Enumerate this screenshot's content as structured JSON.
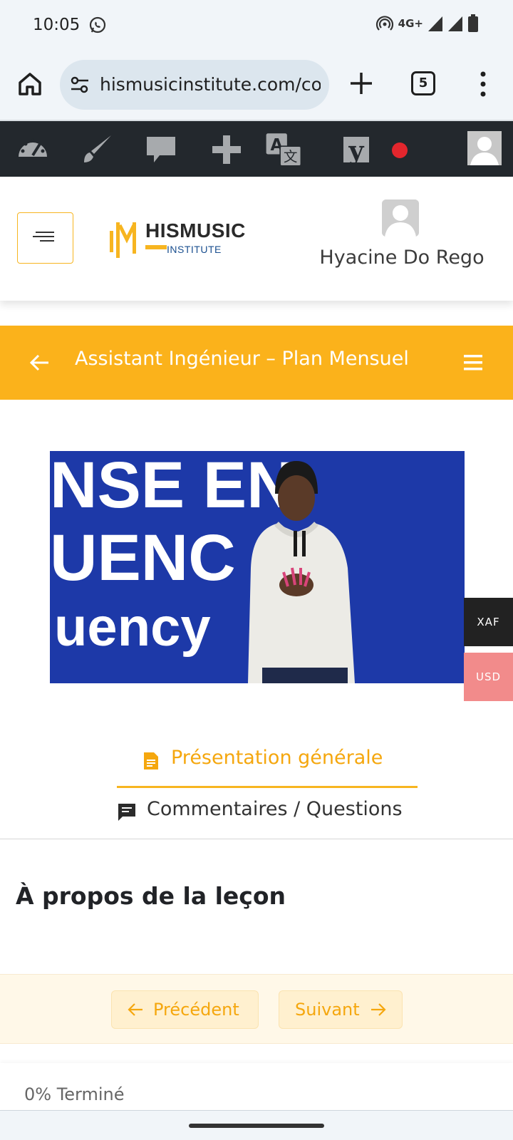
{
  "status_bar": {
    "time": "10:05",
    "network": "4G+"
  },
  "browser": {
    "url": "hismusicinstitute.com/co",
    "tab_count": "5"
  },
  "site": {
    "logo_title": "HISMUSIC",
    "logo_subtitle": "INSTITUTE",
    "user_name": "Hyacine Do Rego"
  },
  "course": {
    "title": "Assistant Ingénieur – Plan Mensuel"
  },
  "video": {
    "lines": [
      "NSE EN",
      "UENC",
      "uency"
    ]
  },
  "currency": {
    "options": [
      "XAF",
      "USD"
    ],
    "selected": "XAF"
  },
  "tabs": {
    "overview": "Présentation générale",
    "comments": "Commentaires / Questions"
  },
  "lesson": {
    "about_heading": "À propos de la leçon"
  },
  "nav": {
    "previous": "Précédent",
    "next": "Suivant"
  },
  "progress": {
    "text": "0% Terminé",
    "percent": 0
  },
  "colors": {
    "accent": "#fbb21b",
    "admin_bar": "#23282d",
    "video_bg": "#1d39a8"
  }
}
